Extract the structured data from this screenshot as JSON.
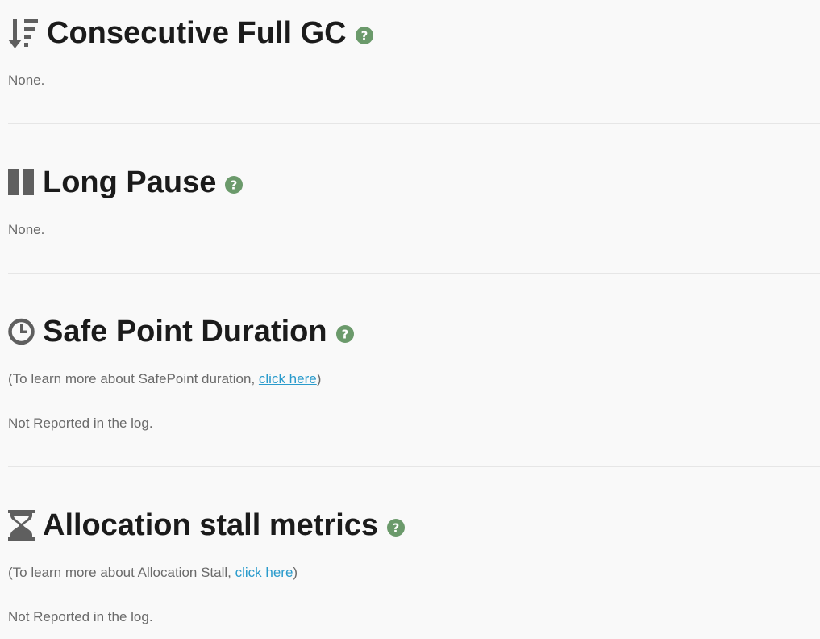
{
  "sections": [
    {
      "title": "Consecutive Full GC",
      "icon": "sort-descending-icon",
      "body": "None."
    },
    {
      "title": "Long Pause",
      "icon": "pause-icon",
      "body": "None."
    },
    {
      "title": "Safe Point Duration",
      "icon": "clock-icon",
      "note_prefix": "(To learn more about SafePoint duration, ",
      "note_link": "click here",
      "note_suffix": ")",
      "body": "Not Reported in the log."
    },
    {
      "title": "Allocation stall metrics",
      "icon": "hourglass-icon",
      "note_prefix": "(To learn more about Allocation Stall, ",
      "note_link": "click here",
      "note_suffix": ")",
      "body": "Not Reported in the log."
    }
  ],
  "colors": {
    "help_icon": "#6b9a6b",
    "section_icon": "#5f5f5f",
    "link": "#2a9bcc",
    "body_text": "#6a6a6a",
    "background": "#f9f9f9"
  }
}
